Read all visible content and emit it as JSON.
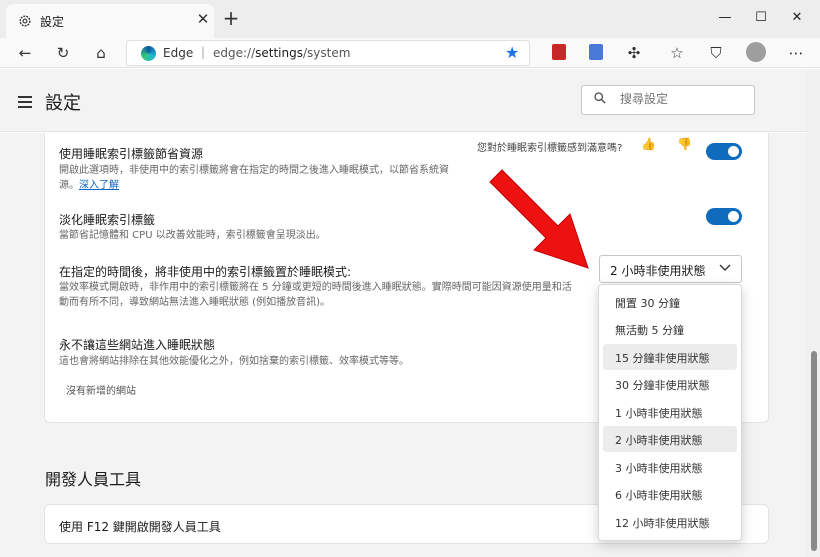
{
  "tab": {
    "title": "設定",
    "close": "✕",
    "new_tab": "+"
  },
  "window_controls": {
    "minimize": "—",
    "maximize": "☐",
    "close": "✕"
  },
  "address_bar": {
    "brand": "Edge",
    "separator": "|",
    "url_scheme": "edge://",
    "url_path": "settings",
    "url_rest": "/system"
  },
  "header": {
    "title": "設定",
    "search_placeholder": "搜尋設定"
  },
  "sleeping_tabs": {
    "title": "使用睡眠索引標籤節省資源",
    "desc_line1": "開啟此選項時，非使用中的索引標籤將會在指定的時間之後進入睡眠模式，以節省系統資",
    "desc_line2_prefix": "源。",
    "learn_more": "深入了解",
    "feedback": "您對於睡眠索引標籤感到滿意嗎?",
    "enabled": true
  },
  "fade_tabs": {
    "title": "淡化睡眠索引標籤",
    "desc": "當節省記憶體和 CPU 以改善效能時，索引標籤會呈現淡出。",
    "enabled": true
  },
  "sleep_after": {
    "title": "在指定的時間後，將非使用中的索引標籤置於睡眠模式:",
    "desc_line1": "當效率模式開啟時，非作用中的索引標籤將在 5 分鐘或更短的時間後進入睡眠狀態。實際時間可能因資源使用量和活",
    "desc_line2": "動而有所不同，導致網站無法進入睡眠狀態 (例如播放音訊)。",
    "selected": "2 小時非使用狀態"
  },
  "never_sleep": {
    "title": "永不讓這些網站進入睡眠狀態",
    "desc": "這也會將網站排除在其他效能優化之外，例如捨棄的索引標籤、效率模式等等。",
    "empty": "沒有新增的網站"
  },
  "developer_tools": {
    "section_title": "開發人員工具",
    "f12_label": "使用 F12 鍵開啟開發人員工具"
  },
  "menu_options": [
    "閒置 30 分鐘",
    "無活動 5 分鐘",
    "15 分鐘非使用狀態",
    "30 分鐘非使用狀態",
    "1 小時非使用狀態",
    "2 小時非使用狀態",
    "3 小時非使用狀態",
    "6 小時非使用狀態",
    "12 小時非使用狀態"
  ],
  "menu_highlighted": [
    "15 分鐘非使用狀態",
    "2 小時非使用狀態"
  ],
  "colors": {
    "accent": "#0f6cbd",
    "annotation_arrow": "#ee1111",
    "favorite_star": "#1a73e8"
  },
  "icons": [
    "gear-icon",
    "back-icon",
    "refresh-icon",
    "home-icon",
    "edge-logo-icon",
    "star-icon",
    "collections-icon",
    "translate-icon",
    "extensions-icon",
    "favorites-icon",
    "security-icon",
    "profile-icon",
    "more-icon",
    "hamburger-icon",
    "search-icon",
    "thumbs-up-icon",
    "thumbs-down-icon",
    "chevron-down-icon"
  ]
}
